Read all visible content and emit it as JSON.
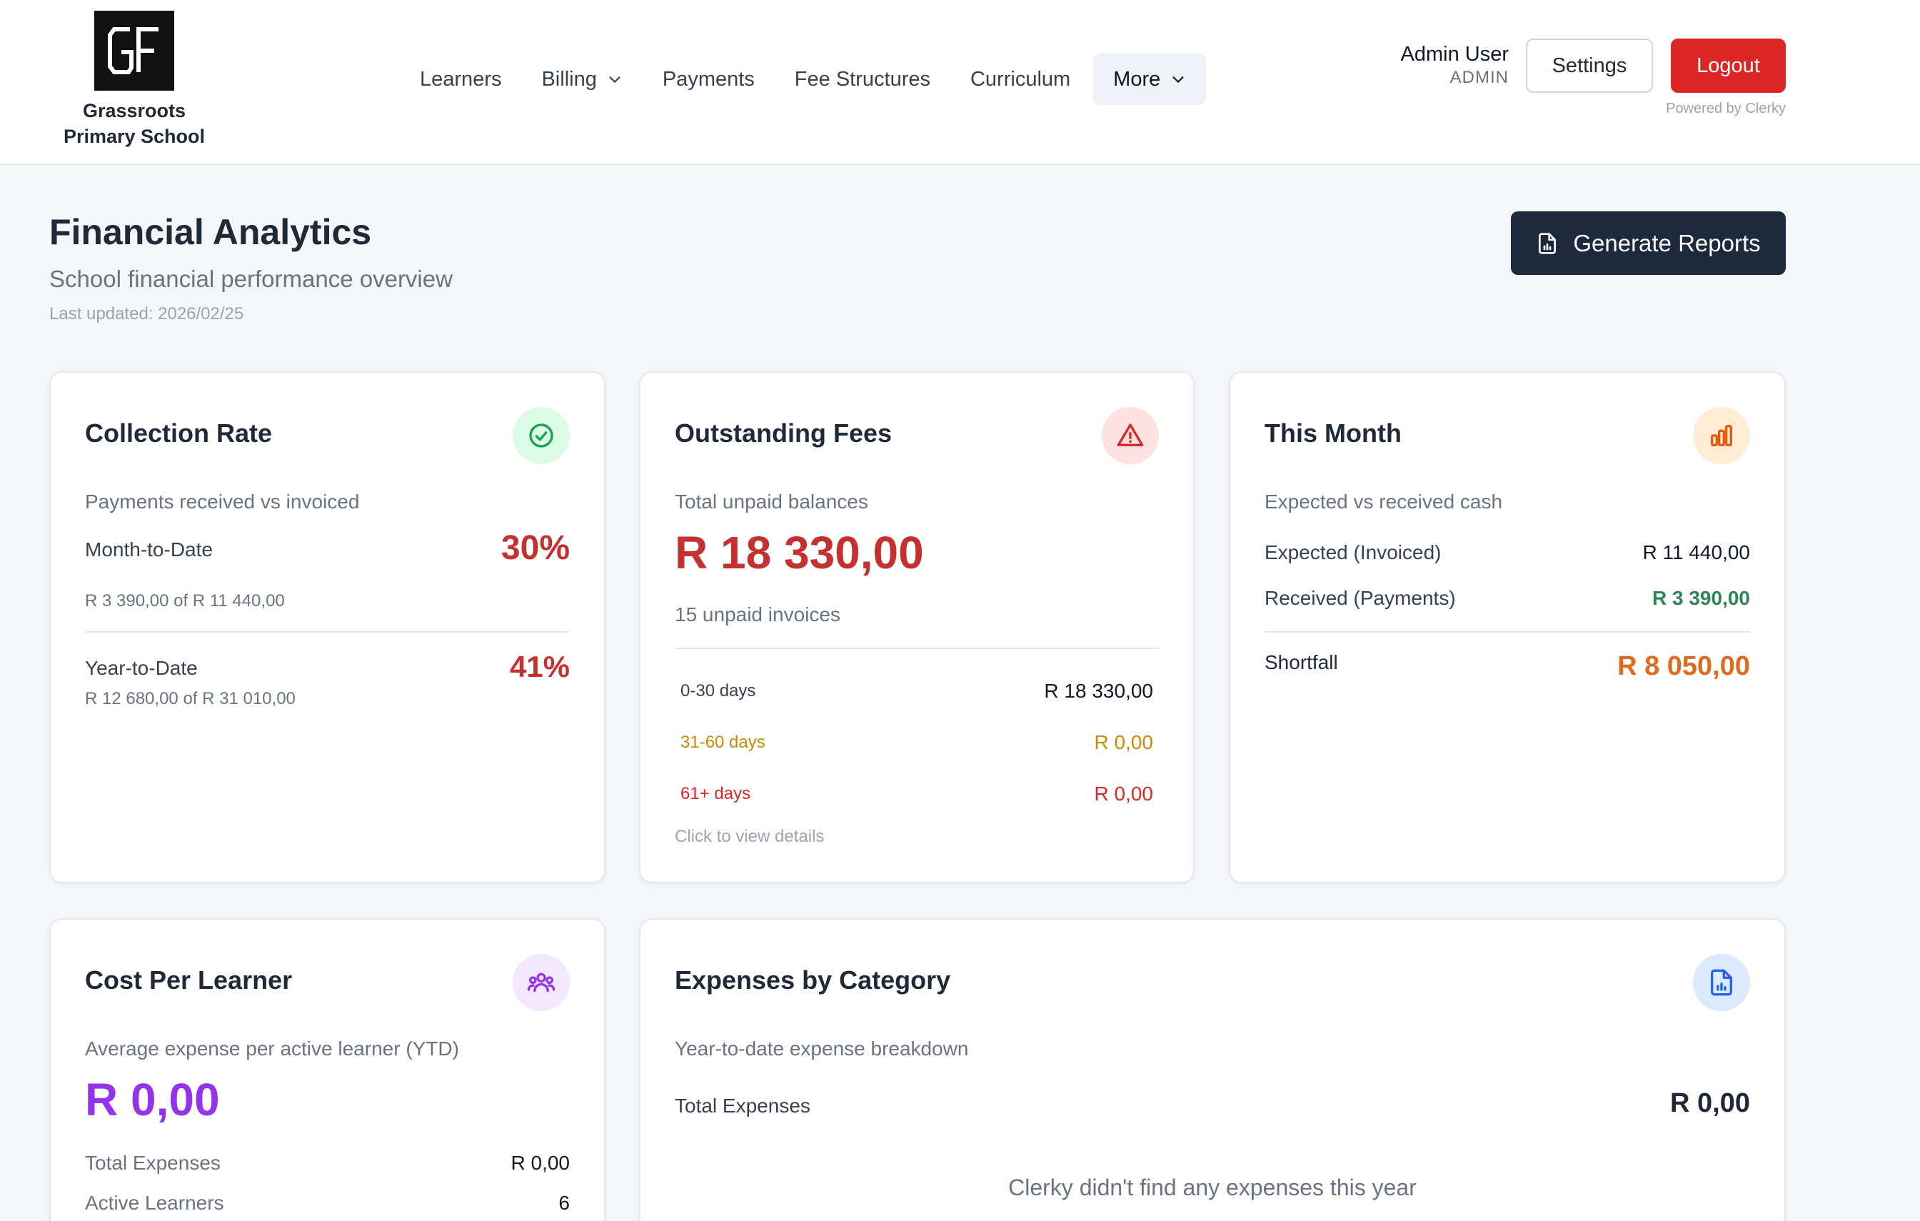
{
  "header": {
    "school_name_line1": "Grassroots",
    "school_name_line2": "Primary School",
    "nav": {
      "learners": "Learners",
      "billing": "Billing",
      "payments": "Payments",
      "fee_structures": "Fee Structures",
      "curriculum": "Curriculum",
      "more": "More"
    },
    "user_name": "Admin User",
    "user_role": "ADMIN",
    "settings_label": "Settings",
    "logout_label": "Logout",
    "powered_by": "Powered by Clerky"
  },
  "page": {
    "title": "Financial Analytics",
    "subtitle": "School financial performance overview",
    "last_updated": "Last updated: 2026/02/25",
    "generate_reports_label": "Generate Reports"
  },
  "collection_rate": {
    "title": "Collection Rate",
    "description": "Payments received vs invoiced",
    "mtd_label": "Month-to-Date",
    "mtd_value": "30%",
    "mtd_detail": "R 3 390,00 of R 11 440,00",
    "ytd_label": "Year-to-Date",
    "ytd_value": "41%",
    "ytd_detail": "R 12 680,00 of R 31 010,00",
    "icon": "check-circle-icon",
    "icon_color": "#16a34a",
    "icon_bg": "#dcfce7"
  },
  "outstanding_fees": {
    "title": "Outstanding Fees",
    "description": "Total unpaid balances",
    "total": "R 18 330,00",
    "unpaid_invoices": "15 unpaid invoices",
    "aging": [
      {
        "label": "0-30 days",
        "value": "R 18 330,00",
        "color": "#374151",
        "value_color": "#111827"
      },
      {
        "label": "31-60 days",
        "value": "R 0,00",
        "color": "#ca8a04",
        "value_color": "#ca8a04"
      },
      {
        "label": "61+ days",
        "value": "R 0,00",
        "color": "#dc2626",
        "value_color": "#dc2626"
      }
    ],
    "view_details": "Click to view details",
    "icon": "alert-triangle-icon",
    "icon_color": "#dc2626",
    "icon_bg": "#fee2e2"
  },
  "this_month": {
    "title": "This Month",
    "description": "Expected vs received cash",
    "expected_label": "Expected (Invoiced)",
    "expected_value": "R 11 440,00",
    "received_label": "Received (Payments)",
    "received_value": "R 3 390,00",
    "shortfall_label": "Shortfall",
    "shortfall_value": "R 8 050,00",
    "icon": "bar-chart-icon",
    "icon_color": "#ea580c",
    "icon_bg": "#ffedd5"
  },
  "cost_per_learner": {
    "title": "Cost Per Learner",
    "description": "Average expense per active learner (YTD)",
    "value": "R 0,00",
    "total_expenses_label": "Total Expenses",
    "total_expenses_value": "R 0,00",
    "active_learners_label": "Active Learners",
    "active_learners_value": "6",
    "icon": "users-icon",
    "icon_color": "#9333ea",
    "icon_bg": "#f3e8ff"
  },
  "expenses_by_category": {
    "title": "Expenses by Category",
    "description": "Year-to-date expense breakdown",
    "total_label": "Total Expenses",
    "total_value": "R 0,00",
    "empty_message": "Clerky didn't find any expenses this year",
    "icon": "file-chart-icon",
    "icon_color": "#2563eb",
    "icon_bg": "#dbeafe"
  },
  "colors": {
    "red": "#c53030",
    "green": "#2f855a",
    "orange": "#dd6b20",
    "purple": "#9333ea",
    "dark": "#1e293b"
  }
}
